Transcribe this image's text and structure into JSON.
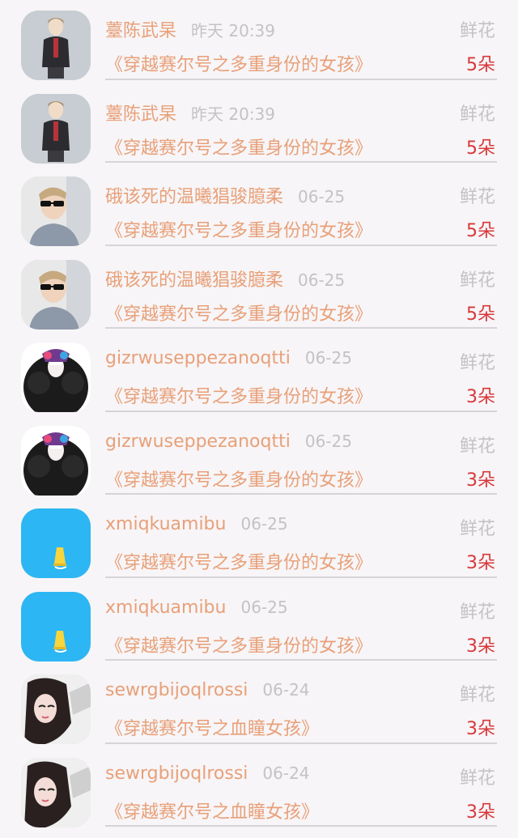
{
  "gift_label": "鲜花",
  "rows": [
    {
      "name": "薹陈武杲",
      "time": "昨天 20:39",
      "book": "《穿越赛尔号之多重身份的女孩》",
      "count": "5朵",
      "avatar": "anime-boy"
    },
    {
      "name": "薹陈武杲",
      "time": "昨天 20:39",
      "book": "《穿越赛尔号之多重身份的女孩》",
      "count": "5朵",
      "avatar": "anime-boy"
    },
    {
      "name": "硪该死的温曦猖骏臆柔",
      "time": "06-25",
      "book": "《穿越赛尔号之多重身份的女孩》",
      "count": "5朵",
      "avatar": "sunglasses-man"
    },
    {
      "name": "硪该死的温曦猖骏臆柔",
      "time": "06-25",
      "book": "《穿越赛尔号之多重身份的女孩》",
      "count": "5朵",
      "avatar": "sunglasses-man"
    },
    {
      "name": "gizrwuseppezanoqtti",
      "time": "06-25",
      "book": "《穿越赛尔号之多重身份的女孩》",
      "count": "3朵",
      "avatar": "feather-costume"
    },
    {
      "name": "gizrwuseppezanoqtti",
      "time": "06-25",
      "book": "《穿越赛尔号之多重身份的女孩》",
      "count": "3朵",
      "avatar": "feather-costume"
    },
    {
      "name": "xmiqkuamibu",
      "time": "06-25",
      "book": "《穿越赛尔号之多重身份的女孩》",
      "count": "3朵",
      "avatar": "blue-sign"
    },
    {
      "name": "xmiqkuamibu",
      "time": "06-25",
      "book": "《穿越赛尔号之多重身份的女孩》",
      "count": "3朵",
      "avatar": "blue-sign"
    },
    {
      "name": "sewrgbijoqlrossi",
      "time": "06-24",
      "book": "《穿越赛尔号之血瞳女孩》",
      "count": "3朵",
      "avatar": "girl-photo"
    },
    {
      "name": "sewrgbijoqlrossi",
      "time": "06-24",
      "book": "《穿越赛尔号之血瞳女孩》",
      "count": "3朵",
      "avatar": "girl-photo"
    }
  ],
  "colors": {
    "name": "#e8a079",
    "time": "#c4c2c4",
    "count": "#d9383a",
    "background": "#f7f5f7"
  }
}
